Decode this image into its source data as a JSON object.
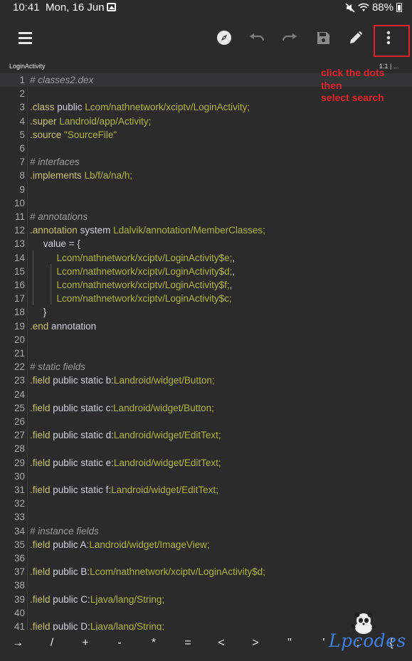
{
  "status_bar": {
    "time": "10:41",
    "date": "Mon, 16 Jun",
    "battery": "88%"
  },
  "tab": {
    "title": "LoginActivity",
    "position": "1:1 | ..."
  },
  "annotation": {
    "line1": "click the dots",
    "line2": "then",
    "line3": "select search"
  },
  "code_lines": [
    {
      "n": "1",
      "segs": [
        [
          "cm",
          "# classes2.dex"
        ]
      ]
    },
    {
      "n": "2",
      "segs": []
    },
    {
      "n": "3",
      "segs": [
        [
          "kw",
          ".class "
        ],
        [
          "plain",
          "public "
        ],
        [
          "str",
          "Lcom/nathnetwork/xciptv/LoginActivity;"
        ]
      ]
    },
    {
      "n": "4",
      "segs": [
        [
          "kw",
          ".super "
        ],
        [
          "str",
          "Landroid/app/Activity;"
        ]
      ]
    },
    {
      "n": "5",
      "segs": [
        [
          "kw",
          ".source "
        ],
        [
          "str",
          "\"SourceFile\""
        ]
      ]
    },
    {
      "n": "6",
      "segs": []
    },
    {
      "n": "7",
      "segs": [
        [
          "cm",
          "# interfaces"
        ]
      ]
    },
    {
      "n": "8",
      "segs": [
        [
          "kw",
          ".implements "
        ],
        [
          "str",
          "Lb/f/a/na/h;"
        ]
      ]
    },
    {
      "n": "9",
      "segs": []
    },
    {
      "n": "10",
      "segs": []
    },
    {
      "n": "11",
      "segs": [
        [
          "cm",
          "# annotations"
        ]
      ]
    },
    {
      "n": "12",
      "segs": [
        [
          "kw",
          ".annotation "
        ],
        [
          "plain",
          "system "
        ],
        [
          "str",
          "Ldalvik/annotation/MemberClasses;"
        ]
      ]
    },
    {
      "n": "13",
      "segs": [
        [
          "plain",
          "     value = {"
        ]
      ]
    },
    {
      "n": "14",
      "segs": [
        [
          "str",
          "          Lcom/nathnetwork/xciptv/LoginActivity$e;"
        ],
        [
          "plain",
          ","
        ]
      ]
    },
    {
      "n": "15",
      "segs": [
        [
          "str",
          "          Lcom/nathnetwork/xciptv/LoginActivity$d;"
        ],
        [
          "plain",
          ","
        ]
      ]
    },
    {
      "n": "16",
      "segs": [
        [
          "str",
          "          Lcom/nathnetwork/xciptv/LoginActivity$f;"
        ],
        [
          "plain",
          ","
        ]
      ]
    },
    {
      "n": "17",
      "segs": [
        [
          "str",
          "          Lcom/nathnetwork/xciptv/LoginActivity$c;"
        ]
      ]
    },
    {
      "n": "18",
      "segs": [
        [
          "plain",
          "     }"
        ]
      ]
    },
    {
      "n": "19",
      "segs": [
        [
          "kw",
          ".end "
        ],
        [
          "plain",
          "annotation"
        ]
      ]
    },
    {
      "n": "20",
      "segs": []
    },
    {
      "n": "21",
      "segs": []
    },
    {
      "n": "22",
      "segs": [
        [
          "cm",
          "# static fields"
        ]
      ]
    },
    {
      "n": "23",
      "segs": [
        [
          "kw",
          ".field "
        ],
        [
          "plain",
          "public static b:"
        ],
        [
          "str",
          "Landroid/widget/Button;"
        ]
      ]
    },
    {
      "n": "24",
      "segs": []
    },
    {
      "n": "25",
      "segs": [
        [
          "kw",
          ".field "
        ],
        [
          "plain",
          "public static c:"
        ],
        [
          "str",
          "Landroid/widget/Button;"
        ]
      ]
    },
    {
      "n": "26",
      "segs": []
    },
    {
      "n": "27",
      "segs": [
        [
          "kw",
          ".field "
        ],
        [
          "plain",
          "public static d:"
        ],
        [
          "str",
          "Landroid/widget/EditText;"
        ]
      ]
    },
    {
      "n": "28",
      "segs": []
    },
    {
      "n": "29",
      "segs": [
        [
          "kw",
          ".field "
        ],
        [
          "plain",
          "public static e:"
        ],
        [
          "str",
          "Landroid/widget/EditText;"
        ]
      ]
    },
    {
      "n": "30",
      "segs": []
    },
    {
      "n": "31",
      "segs": [
        [
          "kw",
          ".field "
        ],
        [
          "plain",
          "public static f:"
        ],
        [
          "str",
          "Landroid/widget/EditText;"
        ]
      ]
    },
    {
      "n": "32",
      "segs": []
    },
    {
      "n": "33",
      "segs": []
    },
    {
      "n": "34",
      "segs": [
        [
          "cm",
          "# instance fields"
        ]
      ]
    },
    {
      "n": "35",
      "segs": [
        [
          "kw",
          ".field "
        ],
        [
          "plain",
          "public A:"
        ],
        [
          "str",
          "Landroid/widget/ImageView;"
        ]
      ]
    },
    {
      "n": "36",
      "segs": []
    },
    {
      "n": "37",
      "segs": [
        [
          "kw",
          ".field "
        ],
        [
          "plain",
          "public B:"
        ],
        [
          "str",
          "Lcom/nathnetwork/xciptv/LoginActivity$d;"
        ]
      ]
    },
    {
      "n": "38",
      "segs": []
    },
    {
      "n": "39",
      "segs": [
        [
          "kw",
          ".field "
        ],
        [
          "plain",
          "public C:"
        ],
        [
          "str",
          "Ljava/lang/String;"
        ]
      ]
    },
    {
      "n": "40",
      "segs": []
    },
    {
      "n": "41",
      "segs": [
        [
          "kw",
          ".field "
        ],
        [
          "plain",
          "public D:"
        ],
        [
          "str",
          "Ljava/lang/String;"
        ]
      ]
    }
  ],
  "keys": [
    "→",
    "/",
    "+",
    "-",
    "*",
    "=",
    "<",
    ">",
    "\"",
    "'",
    ";",
    "{"
  ],
  "watermark": "Lpcodes",
  "colors": {
    "background": "#2b2b2b",
    "keyword": "#c8c16d",
    "string": "#b0b53a",
    "comment": "#9a9a9a",
    "annotation": "#e0242b"
  }
}
